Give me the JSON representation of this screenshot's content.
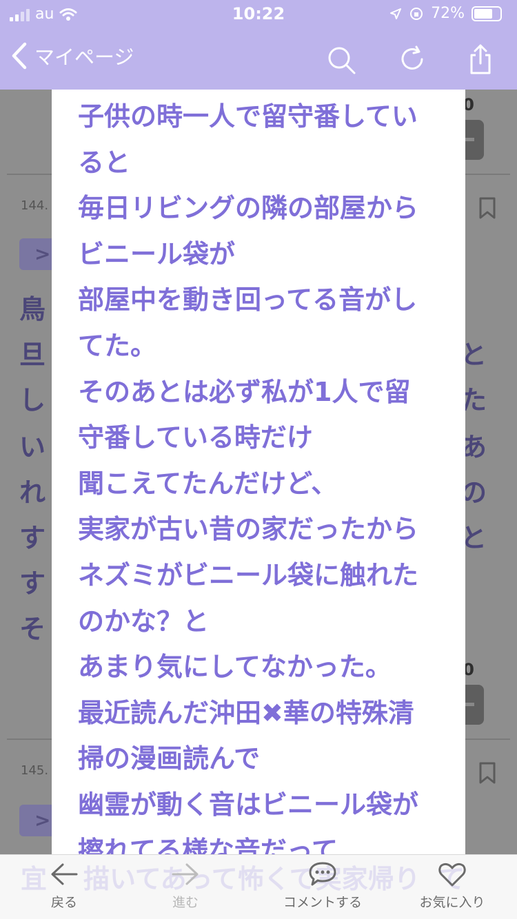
{
  "status_bar": {
    "carrier": "au",
    "time": "10:22",
    "battery": "72%",
    "battery_level": 0.72
  },
  "nav": {
    "back_label": "マイページ",
    "icons": [
      "chevron-left-icon",
      "search-icon",
      "reload-icon",
      "share-icon"
    ]
  },
  "background": {
    "post_numbers": [
      "144.",
      "145."
    ],
    "reply_marker": ">",
    "left_fragments": [
      "鳥",
      "旦",
      "し",
      "い",
      "れ",
      "す",
      "す",
      "そ",
      "宜"
    ],
    "right_fragments": [
      "と",
      "た",
      "あ",
      "の",
      "と",
      "て"
    ],
    "counter": "0"
  },
  "modal": {
    "lines": [
      "子供の時一人で留守番してい",
      "ると",
      "毎日リビングの隣の部屋から",
      "ビニール袋が",
      "部屋中を動き回ってる音がし",
      "てた。",
      "そのあとは必ず私が1人で留",
      "守番している時だけ",
      "聞こえてたんだけど、",
      "実家が古い昔の家だったから",
      "ネズミがビニール袋に触れた",
      "のかな？と",
      "あまり気にしてなかった。",
      "最近読んだ沖田✖華の特殊清",
      "掃の漫画読んで",
      "幽霊が動く音はビニール袋が",
      "擦れてる様な音だって"
    ],
    "overflow_line": "描いてあって怖くて実家帰り"
  },
  "toolbar": {
    "back_label": "戻る",
    "forward_label": "進む",
    "comment_label": "コメントする",
    "favorite_label": "お気に入り"
  },
  "colors": {
    "accent": "#bdb4ec",
    "text_purple": "#7f6fd8"
  }
}
